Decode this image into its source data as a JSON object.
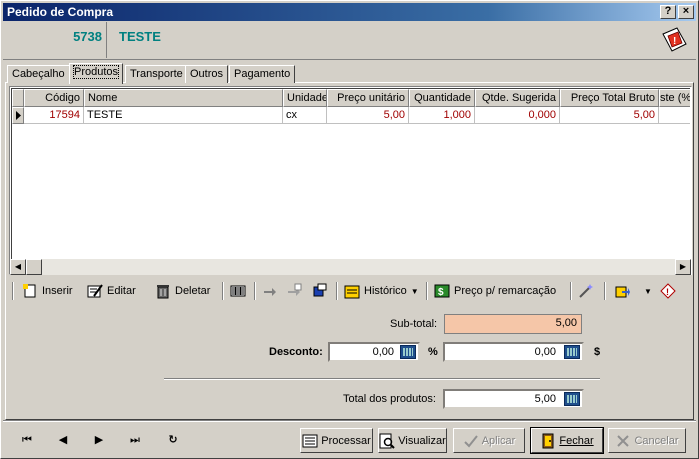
{
  "window": {
    "title": "Pedido de Compra",
    "help_label": "?",
    "close_label": "×"
  },
  "header": {
    "order_number": "5738",
    "supplier_name": "TESTE"
  },
  "tabs": [
    {
      "label": "Cabeçalho"
    },
    {
      "label": "Produtos"
    },
    {
      "label": "Transporte"
    },
    {
      "label": "Outros"
    },
    {
      "label": "Pagamento"
    }
  ],
  "grid": {
    "columns": [
      "Código",
      "Nome",
      "Unidade",
      "Preço unitário",
      "Quantidade",
      "Qtde. Sugerida",
      "Preço Total Bruto",
      "ste (%)"
    ],
    "rows": [
      [
        "17594",
        "TESTE",
        "cx",
        "5,00",
        "1,000",
        "0,000",
        "5,00",
        ""
      ]
    ]
  },
  "toolbar": {
    "insert_label": "Inserir",
    "edit_label": "Editar",
    "delete_label": "Deletar",
    "history_label": "Histórico",
    "price_label": "Preço p/ remarcação"
  },
  "totals": {
    "subtotal_label": "Sub-total:",
    "subtotal_value": "5,00",
    "discount_label": "Desconto:",
    "discount_value": "0,00",
    "percent_symbol": "%",
    "discount_currency_value": "0,00",
    "currency_symbol": "$",
    "total_label": "Total dos produtos:",
    "total_value": "5,00"
  },
  "buttons": {
    "process_label": "Processar",
    "view_label": "Visualizar",
    "apply_label": "Aplicar",
    "close_label": "Fechar",
    "cancel_label": "Cancelar"
  },
  "nav": {
    "first": "⏮",
    "prev": "◀",
    "next": "▶",
    "last": "⏭",
    "refresh": "↻"
  }
}
